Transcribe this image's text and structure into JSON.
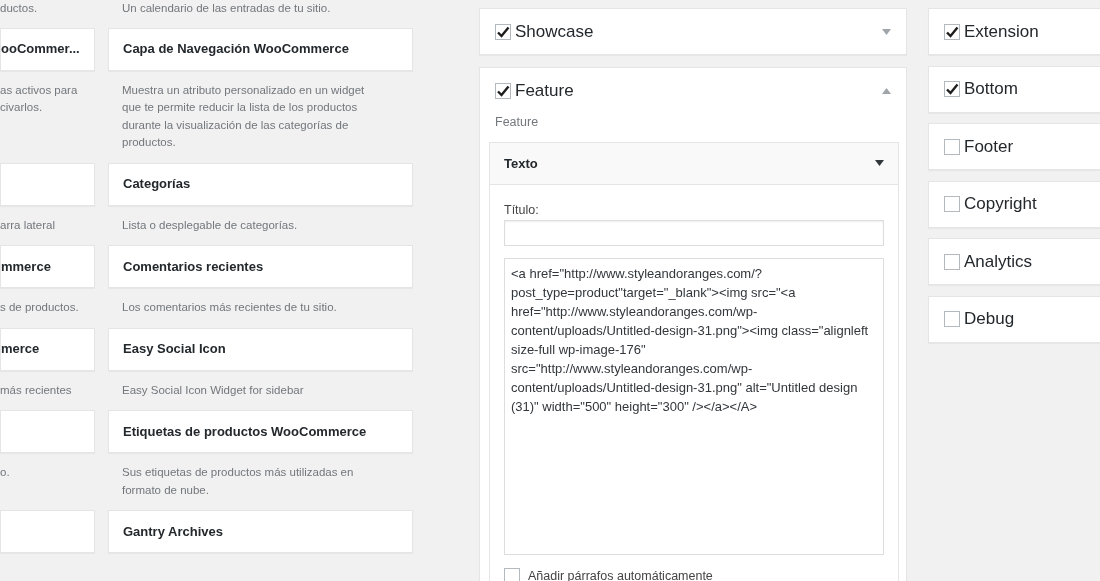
{
  "available_widgets": [
    {
      "left": {
        "kind": "description",
        "description": "ductos."
      },
      "right": {
        "kind": "description",
        "description": "Un calendario de las entradas de tu sitio."
      }
    },
    {
      "left": {
        "kind": "item",
        "title": "ooCommer..."
      },
      "right": {
        "kind": "item",
        "title": "Capa de Navegación WooCommerce"
      }
    },
    {
      "left": {
        "kind": "description",
        "description": "as activos para civarlos."
      },
      "right": {
        "kind": "description",
        "description": "Muestra un atributo personalizado en un widget que te permite reducir la lista de los productos durante la visualización de las categorías de productos."
      }
    },
    {
      "left": {
        "kind": "item"
      },
      "right": {
        "kind": "item",
        "title": "Categorías"
      }
    },
    {
      "left": {
        "kind": "description",
        "description": "arra lateral"
      },
      "right": {
        "kind": "description",
        "description": "Lista o desplegable de categorías."
      }
    },
    {
      "left": {
        "kind": "item",
        "title": "mmerce"
      },
      "right": {
        "kind": "item",
        "title": "Comentarios recientes"
      }
    },
    {
      "left": {
        "kind": "description",
        "description": "s de productos."
      },
      "right": {
        "kind": "description",
        "description": "Los comentarios más recientes de tu sitio."
      }
    },
    {
      "left": {
        "kind": "item",
        "title": "merce"
      },
      "right": {
        "kind": "item",
        "title": "Easy Social Icon"
      }
    },
    {
      "left": {
        "kind": "description",
        "description": "más recientes"
      },
      "right": {
        "kind": "description",
        "description": "Easy Social Icon Widget for sidebar"
      }
    },
    {
      "left": {
        "kind": "item"
      },
      "right": {
        "kind": "item",
        "title": "Etiquetas de productos WooCommerce"
      }
    },
    {
      "left": {
        "kind": "description",
        "description": "o."
      },
      "right": {
        "kind": "description",
        "description": "Sus etiquetas de productos más utilizadas en formato de nube."
      }
    },
    {
      "left": {
        "kind": "item"
      },
      "right": {
        "kind": "item",
        "title": "Gantry Archives"
      }
    }
  ],
  "sidebars": [
    {
      "title": "Showcase",
      "checked": true,
      "expanded": false
    },
    {
      "title": "Feature",
      "checked": true,
      "expanded": true,
      "description": "Feature",
      "widgets": [
        {
          "title": "Texto",
          "expanded": true,
          "fields": {
            "title_label": "Título:",
            "content": "<a href=\"http://www.styleandoranges.com/?post_type=product\"target=\"_blank\"><img src=\"<a href=\"http://www.styleandoranges.com/wp-content/uploads/Untitled-design-31.png\"><img class=\"alignleft size-full wp-image-176\" src=\"http://www.styleandoranges.com/wp-content/uploads/Untitled-design-31.png\" alt=\"Untitled design (31)\" width=\"500\" height=\"300\" /></a></A>",
            "auto_paragraphs": {
              "label": "Añadir párrafos automáticamente",
              "checked": false
            }
          }
        }
      ]
    }
  ],
  "more_sidebars": [
    {
      "title": "Extension",
      "checked": true
    },
    {
      "title": "Bottom",
      "checked": true
    },
    {
      "title": "Footer",
      "checked": false
    },
    {
      "title": "Copyright",
      "checked": false
    },
    {
      "title": "Analytics",
      "checked": false
    },
    {
      "title": "Debug",
      "checked": false
    }
  ]
}
